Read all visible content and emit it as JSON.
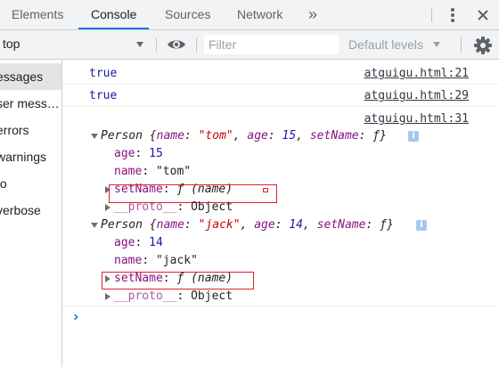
{
  "tabs": {
    "elements": "Elements",
    "console": "Console",
    "sources": "Sources",
    "network": "Network",
    "more": "»"
  },
  "toolbar": {
    "context": "top",
    "filter_placeholder": "Filter",
    "levels": "Default levels"
  },
  "sidebar": {
    "items": [
      "essages",
      "ser mess…",
      "errors",
      "warnings",
      "fo",
      "verbose"
    ]
  },
  "console": {
    "entries": [
      {
        "text": "true",
        "source": "atguigu.html:21"
      },
      {
        "text": "true",
        "source": "atguigu.html:29"
      },
      {
        "source": "atguigu.html:31"
      }
    ],
    "obj1": {
      "type": "Person",
      "summary_key1": "name",
      "summary_val1": "\"tom\"",
      "summary_key2": "age",
      "summary_val2": "15",
      "summary_key3": "setName",
      "summary_val3": "ƒ",
      "age_key": "age",
      "age_val": "15",
      "name_key": "name",
      "name_val": "\"tom\"",
      "fn_key": "setName",
      "fn_f": "ƒ",
      "fn_sig": "(name)",
      "proto_key": "__proto__",
      "proto_val": "Object"
    },
    "obj2": {
      "type": "Person",
      "summary_key1": "name",
      "summary_val1": "\"jack\"",
      "summary_key2": "age",
      "summary_val2": "14",
      "summary_key3": "setName",
      "summary_val3": "ƒ",
      "age_key": "age",
      "age_val": "14",
      "name_key": "name",
      "name_val": "\"jack\"",
      "fn_key": "setName",
      "fn_f": "ƒ",
      "fn_sig": "(name)",
      "proto_key": "__proto__",
      "proto_val": "Object"
    },
    "info_glyph": "i",
    "prompt": "›"
  },
  "colors": {
    "accent": "#1a73e8",
    "highlight_box": "#e0202a"
  }
}
